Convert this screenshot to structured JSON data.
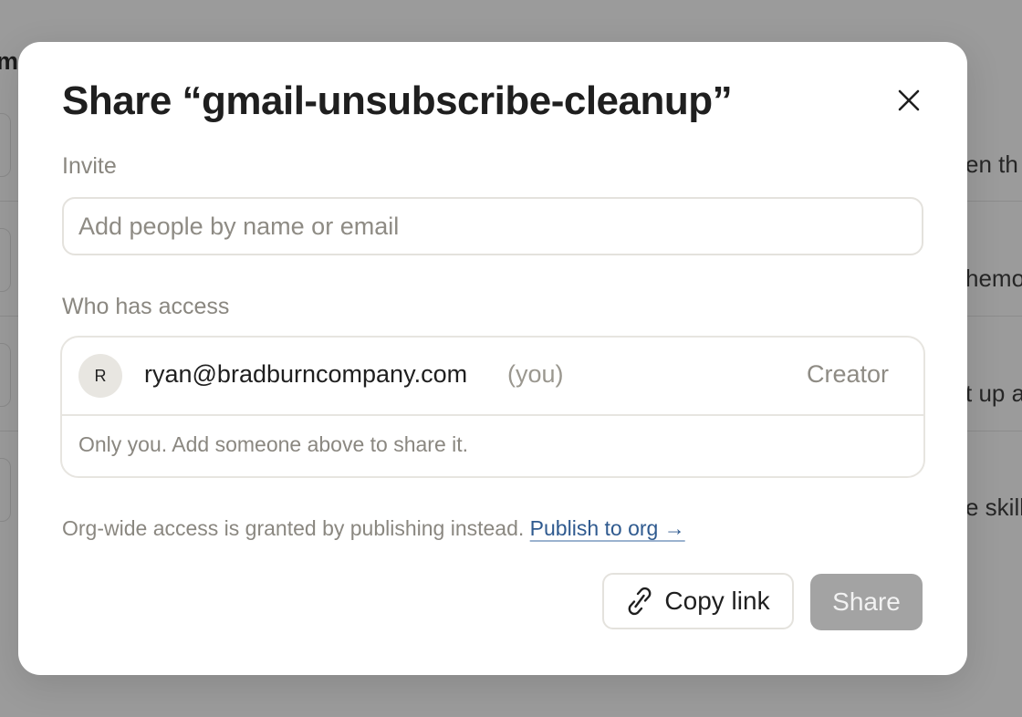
{
  "background": {
    "heading_fragment": "m",
    "row_fragments": [
      "en th",
      "hemo",
      "t up a",
      "e skill"
    ]
  },
  "modal": {
    "title": "Share “gmail-unsubscribe-cleanup”",
    "close_icon": "close-icon",
    "invite_label": "Invite",
    "invite_placeholder": "Add people by name or email",
    "invite_value": "",
    "access_label": "Who has access",
    "members": [
      {
        "avatar_initial": "R",
        "email": "ryan@bradburncompany.com",
        "you_tag": "(you)",
        "role": "Creator"
      }
    ],
    "access_note": "Only you. Add someone above to share it.",
    "org_note": "Org-wide access is granted by publishing instead.",
    "publish_link": "Publish to org →",
    "copy_link_label": "Copy link",
    "copy_link_icon": "link-icon",
    "share_label": "Share",
    "share_disabled": true
  },
  "colors": {
    "overlay": "#9b9b9b",
    "link": "#2f5a8f",
    "share_disabled": "#a3a3a3",
    "muted_text": "#8a8780"
  }
}
